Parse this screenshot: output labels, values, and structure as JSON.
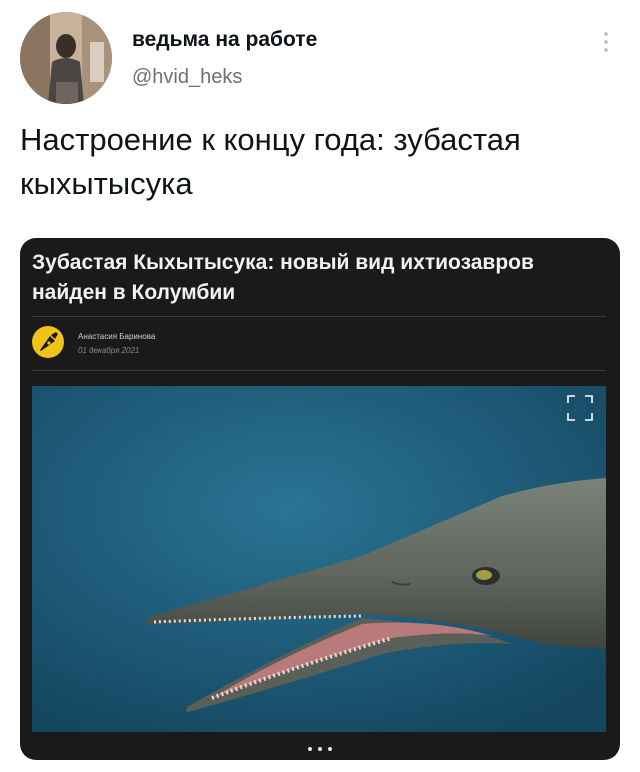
{
  "tweet": {
    "author_name": "ведьма на работе",
    "handle": "@hvid_heks",
    "text": "Настроение к концу года: зубастая кыхытысука",
    "more_icon": "more-vertical-icon",
    "avatar_icon": "profile-photo"
  },
  "card": {
    "headline": "Зубастая Кыхытысука: новый вид ихтиозавров найден в Колумбии",
    "author": "Анастасия Баринова",
    "date": "01 декабря 2021",
    "logo_icon": "pen-nib-logo",
    "expand_icon": "fullscreen-icon",
    "image_subject": "ichthyosaur-illustration",
    "colors": {
      "background": "#1a1a1a",
      "photo_background": "#1f5f7d",
      "logo": "#f2c317"
    },
    "carousel_dots": 3
  }
}
